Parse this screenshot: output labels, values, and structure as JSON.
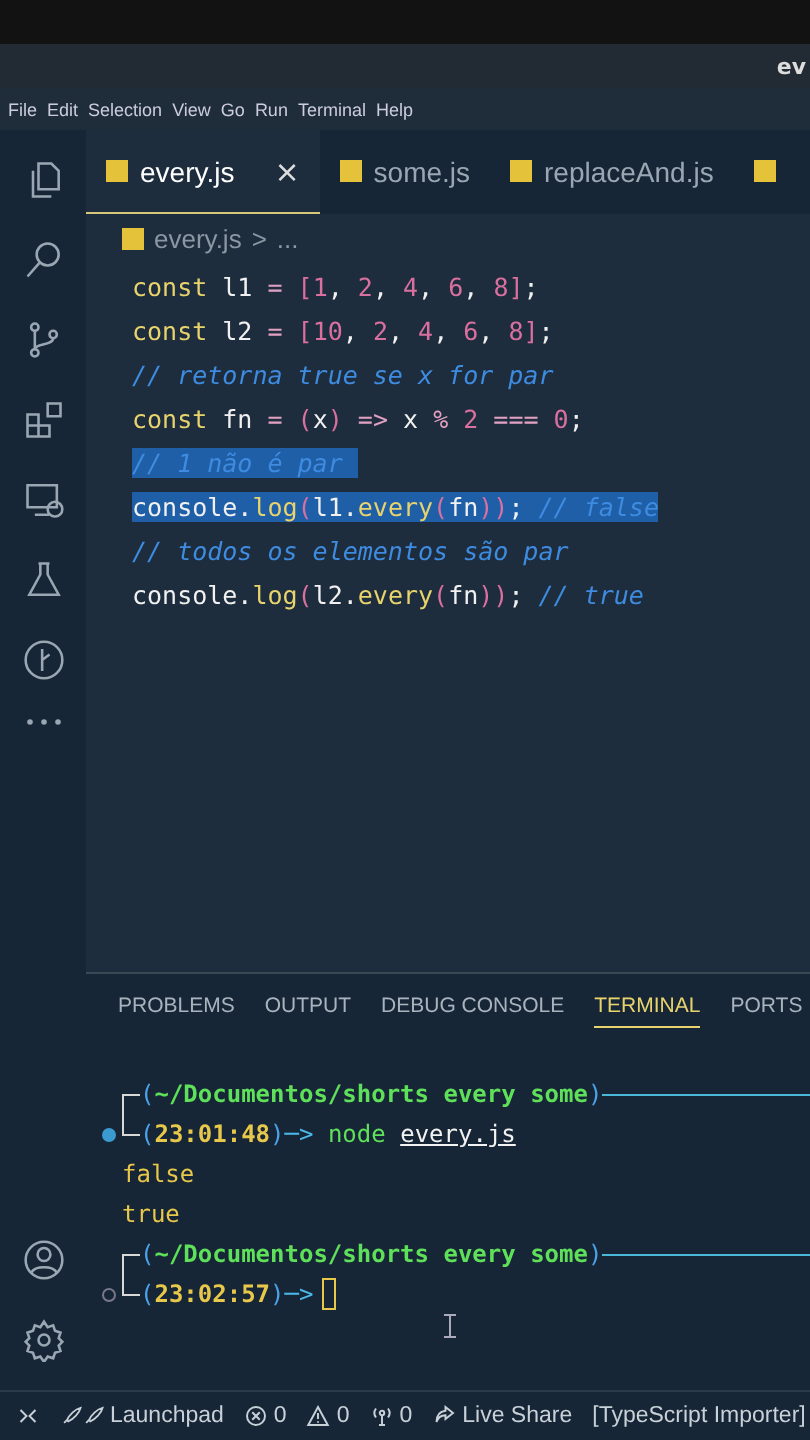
{
  "window": {
    "title": "ev"
  },
  "menu": [
    "File",
    "Edit",
    "Selection",
    "View",
    "Go",
    "Run",
    "Terminal",
    "Help"
  ],
  "tabs": [
    {
      "label": "every.js",
      "selected": true,
      "close": "×"
    },
    {
      "label": "some.js",
      "selected": false
    },
    {
      "label": "replaceAnd.js",
      "selected": false
    },
    {
      "selected": false
    }
  ],
  "breadcrumb": {
    "file": "every.js",
    "separator": ">",
    "rest": "..."
  },
  "code": [
    {
      "highlighted": false,
      "tokens": [
        {
          "kind": "keyword",
          "text": "const "
        },
        {
          "kind": "plain",
          "text": "l1 "
        },
        {
          "kind": "op",
          "text": "= "
        },
        {
          "kind": "bracket",
          "text": "["
        },
        {
          "kind": "number",
          "text": "1"
        },
        {
          "kind": "plain",
          "text": ", "
        },
        {
          "kind": "number",
          "text": "2"
        },
        {
          "kind": "plain",
          "text": ", "
        },
        {
          "kind": "number",
          "text": "4"
        },
        {
          "kind": "plain",
          "text": ", "
        },
        {
          "kind": "number",
          "text": "6"
        },
        {
          "kind": "plain",
          "text": ", "
        },
        {
          "kind": "number",
          "text": "8"
        },
        {
          "kind": "bracket",
          "text": "]"
        },
        {
          "kind": "plain",
          "text": ";"
        }
      ]
    },
    {
      "highlighted": false,
      "tokens": [
        {
          "kind": "keyword",
          "text": "const "
        },
        {
          "kind": "plain",
          "text": "l2 "
        },
        {
          "kind": "op",
          "text": "= "
        },
        {
          "kind": "bracket",
          "text": "["
        },
        {
          "kind": "number",
          "text": "10"
        },
        {
          "kind": "plain",
          "text": ", "
        },
        {
          "kind": "number",
          "text": "2"
        },
        {
          "kind": "plain",
          "text": ", "
        },
        {
          "kind": "number",
          "text": "4"
        },
        {
          "kind": "plain",
          "text": ", "
        },
        {
          "kind": "number",
          "text": "6"
        },
        {
          "kind": "plain",
          "text": ", "
        },
        {
          "kind": "number",
          "text": "8"
        },
        {
          "kind": "bracket",
          "text": "]"
        },
        {
          "kind": "plain",
          "text": ";"
        }
      ]
    },
    {
      "highlighted": false,
      "tokens": [
        {
          "kind": "comment",
          "text": "// retorna true se x for par"
        }
      ]
    },
    {
      "highlighted": false,
      "tokens": [
        {
          "kind": "keyword",
          "text": "const "
        },
        {
          "kind": "plain",
          "text": "fn "
        },
        {
          "kind": "op",
          "text": "= "
        },
        {
          "kind": "bracket",
          "text": "("
        },
        {
          "kind": "plain",
          "text": "x"
        },
        {
          "kind": "bracket",
          "text": ")"
        },
        {
          "kind": "op",
          "text": " => "
        },
        {
          "kind": "plain",
          "text": "x "
        },
        {
          "kind": "op",
          "text": "% "
        },
        {
          "kind": "number",
          "text": "2"
        },
        {
          "kind": "op",
          "text": " === "
        },
        {
          "kind": "number",
          "text": "0"
        },
        {
          "kind": "plain",
          "text": ";"
        }
      ]
    },
    {
      "highlighted": true,
      "tokens": [
        {
          "kind": "comment",
          "text": "// 1 não é par "
        }
      ]
    },
    {
      "highlighted": true,
      "tokens": [
        {
          "kind": "plain",
          "text": "console."
        },
        {
          "kind": "function",
          "text": "log"
        },
        {
          "kind": "bracket",
          "text": "("
        },
        {
          "kind": "plain",
          "text": "l1."
        },
        {
          "kind": "function",
          "text": "every"
        },
        {
          "kind": "bracket",
          "text": "("
        },
        {
          "kind": "plain",
          "text": "fn"
        },
        {
          "kind": "bracket",
          "text": "))"
        },
        {
          "kind": "plain",
          "text": "; "
        },
        {
          "kind": "comment",
          "text": "// false"
        }
      ]
    },
    {
      "highlighted": false,
      "tokens": [
        {
          "kind": "comment",
          "text": "// todos os elementos são par"
        }
      ]
    },
    {
      "highlighted": false,
      "tokens": [
        {
          "kind": "plain",
          "text": "console."
        },
        {
          "kind": "function",
          "text": "log"
        },
        {
          "kind": "bracket",
          "text": "("
        },
        {
          "kind": "plain",
          "text": "l2."
        },
        {
          "kind": "function",
          "text": "every"
        },
        {
          "kind": "bracket",
          "text": "("
        },
        {
          "kind": "plain",
          "text": "fn"
        },
        {
          "kind": "bracket",
          "text": "))"
        },
        {
          "kind": "plain",
          "text": "; "
        },
        {
          "kind": "comment",
          "text": "// true"
        }
      ]
    }
  ],
  "panel_tabs": [
    {
      "label": "PROBLEMS",
      "selected": false
    },
    {
      "label": "OUTPUT",
      "selected": false
    },
    {
      "label": "DEBUG CONSOLE",
      "selected": false
    },
    {
      "label": "TERMINAL",
      "selected": true
    },
    {
      "label": "PORTS",
      "selected": false
    }
  ],
  "terminal": [
    {
      "kind": "path",
      "open": "(",
      "text": "~/Documentos/shorts every some",
      "close": ")"
    },
    {
      "kind": "prompt",
      "finished": true,
      "open": "(",
      "time": "23:01:48",
      "close": ")",
      "arrow": "─>",
      "command": "node",
      "arg": "every.js"
    },
    {
      "kind": "output",
      "text": "false"
    },
    {
      "kind": "output",
      "text": "true"
    },
    {
      "kind": "path",
      "open": "(",
      "text": "~/Documentos/shorts every some",
      "close": ")"
    },
    {
      "kind": "prompt",
      "finished": false,
      "open": "(",
      "time": "23:02:57",
      "close": ")",
      "arrow": "─>"
    }
  ],
  "status_bar": [
    {
      "kind": "remote"
    },
    {
      "kind": "launchpad",
      "text": "Launchpad"
    },
    {
      "kind": "errors",
      "text": "0"
    },
    {
      "kind": "warnings",
      "text": "0"
    },
    {
      "kind": "ports",
      "text": "0"
    },
    {
      "kind": "liveshare",
      "text": "Live Share"
    },
    {
      "kind": "text",
      "text": "[TypeScript Importer]"
    }
  ]
}
